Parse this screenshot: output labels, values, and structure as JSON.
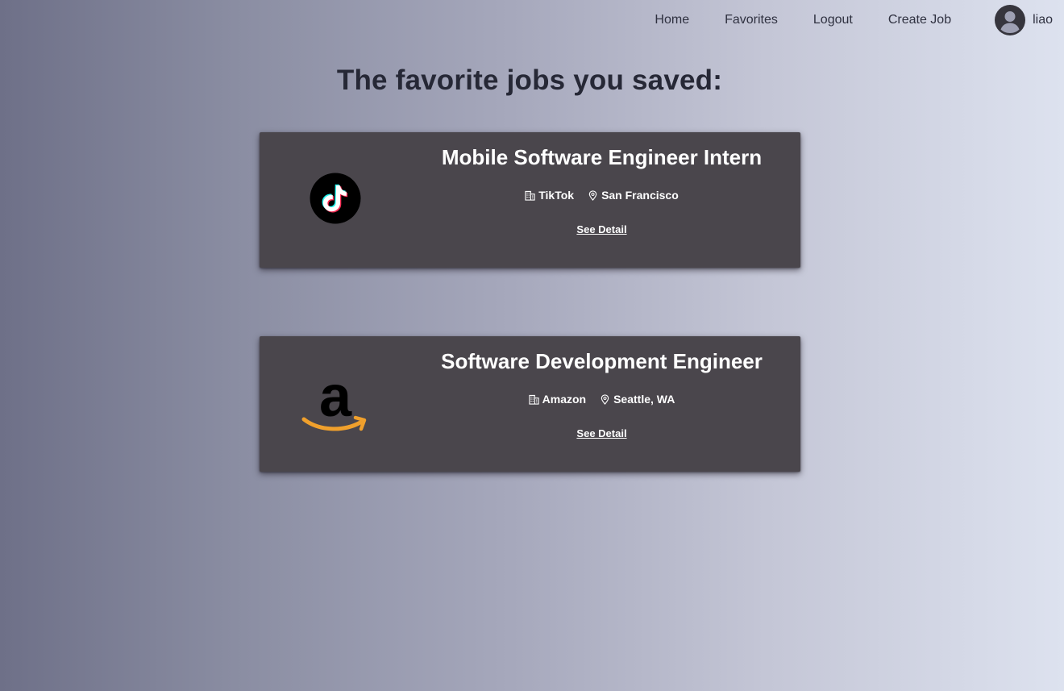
{
  "navbar": {
    "links": [
      "Home",
      "Favorites",
      "Logout",
      "Create Job"
    ],
    "username": "liao"
  },
  "page": {
    "title": "The favorite jobs you saved:"
  },
  "jobs": [
    {
      "title": "Mobile Software Engineer Intern",
      "company": "TikTok",
      "location": "San Francisco",
      "link_label": "See Detail",
      "logo": "tiktok-logo"
    },
    {
      "title": "Software Development Engineer",
      "company": "Amazon",
      "location": "Seattle, WA",
      "link_label": "See Detail",
      "logo": "amazon-logo"
    }
  ],
  "colors": {
    "card_background": "#4a464c",
    "amazon_orange": "#f0a02c",
    "tiktok_cyan": "#25f4ee",
    "tiktok_red": "#fe2c55"
  }
}
